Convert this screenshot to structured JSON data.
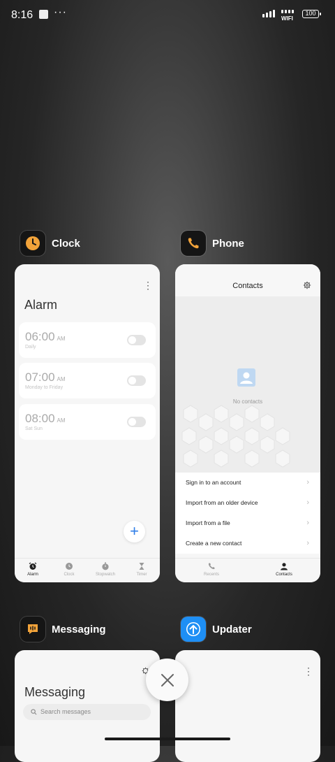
{
  "status_bar": {
    "time": "8:16",
    "ellipsis": "···",
    "wifi_label": "WIFI",
    "battery": "100"
  },
  "apps": [
    {
      "name": "Clock",
      "icon": "clock-icon",
      "screen": {
        "title": "Alarm",
        "alarms": [
          {
            "time": "06:00",
            "ampm": "AM",
            "repeat": "Daily"
          },
          {
            "time": "07:00",
            "ampm": "AM",
            "repeat": "Monday to Friday"
          },
          {
            "time": "08:00",
            "ampm": "AM",
            "repeat": "Sat Sun"
          }
        ],
        "nav": [
          "Alarm",
          "Clock",
          "Stopwatch",
          "Timer"
        ]
      }
    },
    {
      "name": "Phone",
      "icon": "phone-icon",
      "screen": {
        "title": "Contacts",
        "empty_text": "No contacts",
        "actions": [
          "Sign in to an account",
          "Import from an older device",
          "Import from a file",
          "Create a new contact"
        ],
        "nav": [
          "Recents",
          "Contacts"
        ]
      }
    },
    {
      "name": "Messaging",
      "icon": "messaging-icon",
      "screen": {
        "title": "Messaging",
        "search_placeholder": "Search messages"
      }
    },
    {
      "name": "Updater",
      "icon": "updater-icon"
    }
  ],
  "colors": {
    "accent_blue": "#2f7ee8",
    "clock_orange": "#f2a33a",
    "updater_blue": "#1e8ff5"
  }
}
